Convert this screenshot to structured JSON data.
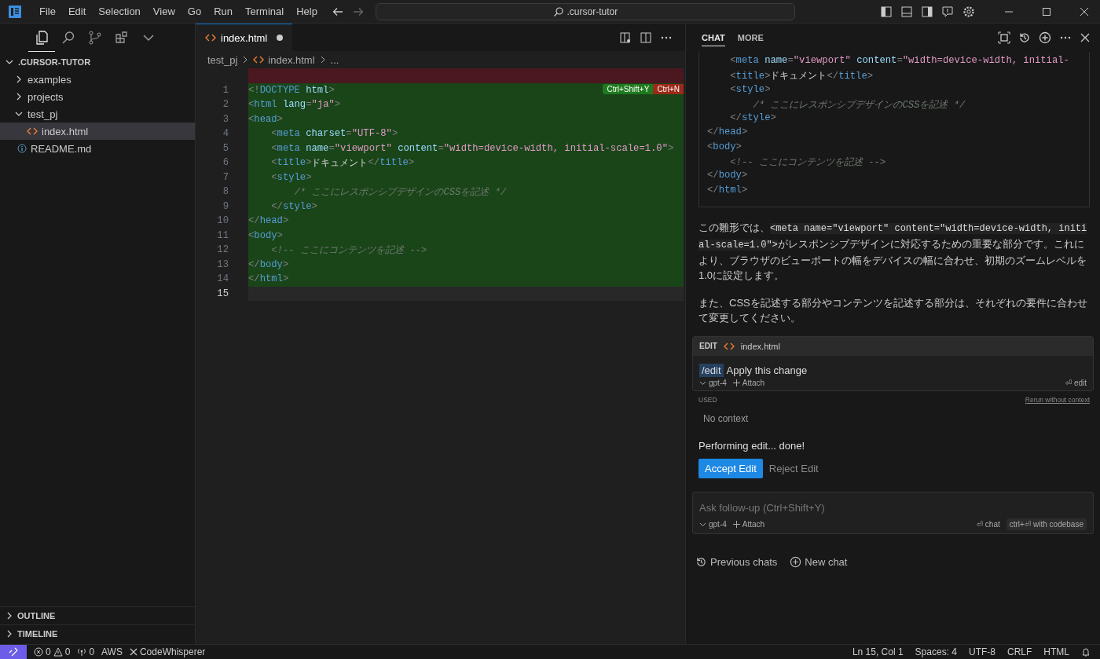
{
  "title_bar": {
    "menus": [
      "File",
      "Edit",
      "Selection",
      "View",
      "Go",
      "Run",
      "Terminal",
      "Help"
    ],
    "search": {
      "value": ".cursor-tutor"
    }
  },
  "sidebar": {
    "views": [
      {
        "selected": true
      },
      {
        "selected": false
      },
      {
        "selected": false
      },
      {
        "selected": false
      },
      {
        "selected": false
      }
    ],
    "tree": [
      {
        "label": ".CURSOR-TUTOR",
        "kind": "root",
        "expanded": true,
        "selected": false,
        "children": [
          {
            "label": "examples",
            "kind": "folder",
            "expanded": false,
            "selected": false
          },
          {
            "label": "projects",
            "kind": "folder",
            "expanded": false,
            "selected": false
          },
          {
            "label": "test_pj",
            "kind": "folder",
            "expanded": true,
            "selected": false,
            "children": [
              {
                "label": "index.html",
                "kind": "html",
                "selected": true
              }
            ]
          },
          {
            "label": "README.md",
            "kind": "info",
            "selected": false
          }
        ]
      }
    ],
    "sections": [
      {
        "label": "OUTLINE",
        "expanded": false
      },
      {
        "label": "TIMELINE",
        "expanded": false
      }
    ]
  },
  "editor": {
    "tab": {
      "label": "index.html",
      "modified": true
    },
    "breadcrumb": [
      "test_pj",
      "index.html",
      "..."
    ],
    "diff_actions": [
      {
        "label": "Ctrl+Shift+Y",
        "kind": "accept"
      },
      {
        "label": "Ctrl+N",
        "kind": "reject"
      }
    ],
    "lines": [
      {
        "kind": "removed",
        "current": false
      },
      {
        "number": "1",
        "kind": "added",
        "current": false,
        "tokens": [
          {
            "kind": "p",
            "t": "<!"
          },
          {
            "kind": "tag",
            "t": "DOCTYPE"
          },
          {
            "kind": "attr",
            "t": " html"
          },
          {
            "kind": "p",
            "t": ">"
          }
        ]
      },
      {
        "number": "2",
        "kind": "added",
        "current": false,
        "tokens": [
          {
            "kind": "p",
            "t": "<"
          },
          {
            "kind": "tag",
            "t": "html"
          },
          {
            "kind": "attr",
            "t": " lang"
          },
          {
            "kind": "p",
            "t": "="
          },
          {
            "kind": "str",
            "t": "\"ja\""
          },
          {
            "kind": "p",
            "t": ">"
          }
        ]
      },
      {
        "number": "3",
        "kind": "added",
        "current": false,
        "tokens": [
          {
            "kind": "p",
            "t": "<"
          },
          {
            "kind": "tag",
            "t": "head"
          },
          {
            "kind": "p",
            "t": ">"
          }
        ]
      },
      {
        "number": "4",
        "kind": "added",
        "current": false,
        "tokens": [
          {
            "kind": "p",
            "t": "    <"
          },
          {
            "kind": "tag",
            "t": "meta"
          },
          {
            "kind": "attr",
            "t": " charset"
          },
          {
            "kind": "p",
            "t": "="
          },
          {
            "kind": "str",
            "t": "\"UTF-8\""
          },
          {
            "kind": "p",
            "t": ">"
          }
        ]
      },
      {
        "number": "5",
        "kind": "added",
        "current": false,
        "tokens": [
          {
            "kind": "p",
            "t": "    <"
          },
          {
            "kind": "tag",
            "t": "meta"
          },
          {
            "kind": "attr",
            "t": " name"
          },
          {
            "kind": "p",
            "t": "="
          },
          {
            "kind": "str",
            "t": "\"viewport\""
          },
          {
            "kind": "attr",
            "t": " content"
          },
          {
            "kind": "p",
            "t": "="
          },
          {
            "kind": "str",
            "t": "\"width=device-width, initial-scale=1.0\""
          },
          {
            "kind": "p",
            "t": ">"
          }
        ]
      },
      {
        "number": "6",
        "kind": "added",
        "current": false,
        "tokens": [
          {
            "kind": "p",
            "t": "    <"
          },
          {
            "kind": "tag",
            "t": "title"
          },
          {
            "kind": "p",
            "t": ">"
          },
          {
            "kind": "text",
            "t": "ドキュメント"
          },
          {
            "kind": "p",
            "t": "</"
          },
          {
            "kind": "tag",
            "t": "title"
          },
          {
            "kind": "p",
            "t": ">"
          }
        ]
      },
      {
        "number": "7",
        "kind": "added",
        "current": false,
        "tokens": [
          {
            "kind": "p",
            "t": "    <"
          },
          {
            "kind": "tag",
            "t": "style"
          },
          {
            "kind": "p",
            "t": ">"
          }
        ]
      },
      {
        "number": "8",
        "kind": "added",
        "current": false,
        "tokens": [
          {
            "kind": "com",
            "t": "        /* ここにレスポンシブデザインのCSSを記述 */"
          }
        ]
      },
      {
        "number": "9",
        "kind": "added",
        "current": false,
        "tokens": [
          {
            "kind": "p",
            "t": "    </"
          },
          {
            "kind": "tag",
            "t": "style"
          },
          {
            "kind": "p",
            "t": ">"
          }
        ]
      },
      {
        "number": "10",
        "kind": "added",
        "current": false,
        "tokens": [
          {
            "kind": "p",
            "t": "</"
          },
          {
            "kind": "tag",
            "t": "head"
          },
          {
            "kind": "p",
            "t": ">"
          }
        ]
      },
      {
        "number": "11",
        "kind": "added",
        "current": false,
        "tokens": [
          {
            "kind": "p",
            "t": "<"
          },
          {
            "kind": "tag",
            "t": "body"
          },
          {
            "kind": "p",
            "t": ">"
          }
        ]
      },
      {
        "number": "12",
        "kind": "added",
        "current": false,
        "tokens": [
          {
            "kind": "com",
            "t": "    <!-- ここにコンテンツを記述 -->"
          }
        ]
      },
      {
        "number": "13",
        "kind": "added",
        "current": false,
        "tokens": [
          {
            "kind": "p",
            "t": "</"
          },
          {
            "kind": "tag",
            "t": "body"
          },
          {
            "kind": "p",
            "t": ">"
          }
        ]
      },
      {
        "number": "14",
        "kind": "added",
        "current": false,
        "tokens": [
          {
            "kind": "p",
            "t": "</"
          },
          {
            "kind": "tag",
            "t": "html"
          },
          {
            "kind": "p",
            "t": ">"
          }
        ]
      },
      {
        "number": "15",
        "kind": "none",
        "current": true
      }
    ]
  },
  "chat": {
    "tabs": [
      {
        "label": "CHAT",
        "selected": true
      },
      {
        "label": "MORE",
        "selected": false
      }
    ],
    "code_block": [
      [
        {
          "kind": "p",
          "t": "    <"
        },
        {
          "kind": "tag",
          "t": "meta"
        },
        {
          "kind": "attr",
          "t": " name"
        },
        {
          "kind": "p",
          "t": "="
        },
        {
          "kind": "str",
          "t": "\"viewport\""
        },
        {
          "kind": "attr",
          "t": " content"
        },
        {
          "kind": "p",
          "t": "="
        },
        {
          "kind": "str",
          "t": "\"width=device-width, initial-"
        }
      ],
      [
        {
          "kind": "p",
          "t": "    <"
        },
        {
          "kind": "tag",
          "t": "title"
        },
        {
          "kind": "p",
          "t": ">"
        },
        {
          "kind": "text",
          "t": "ドキュメント"
        },
        {
          "kind": "p",
          "t": "</"
        },
        {
          "kind": "tag",
          "t": "title"
        },
        {
          "kind": "p",
          "t": ">"
        }
      ],
      [
        {
          "kind": "p",
          "t": "    <"
        },
        {
          "kind": "tag",
          "t": "style"
        },
        {
          "kind": "p",
          "t": ">"
        }
      ],
      [
        {
          "kind": "com",
          "t": "        /* ここにレスポンシブデザインのCSSを記述 */"
        }
      ],
      [
        {
          "kind": "p",
          "t": "    </"
        },
        {
          "kind": "tag",
          "t": "style"
        },
        {
          "kind": "p",
          "t": ">"
        }
      ],
      [
        {
          "kind": "p",
          "t": "</"
        },
        {
          "kind": "tag",
          "t": "head"
        },
        {
          "kind": "p",
          "t": ">"
        }
      ],
      [
        {
          "kind": "p",
          "t": "<"
        },
        {
          "kind": "tag",
          "t": "body"
        },
        {
          "kind": "p",
          "t": ">"
        }
      ],
      [
        {
          "kind": "com",
          "t": "    <!-- ここにコンテンツを記述 -->"
        }
      ],
      [
        {
          "kind": "p",
          "t": "</"
        },
        {
          "kind": "tag",
          "t": "body"
        },
        {
          "kind": "p",
          "t": ">"
        }
      ],
      [
        {
          "kind": "p",
          "t": "</"
        },
        {
          "kind": "tag",
          "t": "html"
        },
        {
          "kind": "p",
          "t": ">"
        }
      ]
    ],
    "paragraphs": [
      [
        {
          "kind": "text",
          "text": "この雛形では、"
        },
        {
          "kind": "code",
          "text": "<meta name=\"viewport\" content=\"width=device-width, initial-scale=1.0\">"
        },
        {
          "kind": "text",
          "text": "がレスポンシブデザインに対応するための重要な部分です。これにより、ブラウザのビューポートの幅をデバイスの幅に合わせ、初期のズームレベルを1.0に設定します。"
        }
      ],
      [
        {
          "kind": "text",
          "text": "また、CSSを記述する部分やコンテンツを記述する部分は、それぞれの要件に合わせて変更してください。"
        }
      ]
    ],
    "edit_card": {
      "label": "EDIT",
      "file": "index.html",
      "command": "/edit",
      "message": "Apply this change",
      "model": "gpt-4",
      "attach": "Attach",
      "submit": "⏎ edit"
    },
    "used": {
      "label": "USED",
      "link": "Rerun without context",
      "context": "No context"
    },
    "status": "Performing edit... done!",
    "accept": "Accept Edit",
    "reject": "Reject Edit",
    "input": {
      "placeholder": "Ask follow-up (Ctrl+Shift+Y)",
      "model": "gpt-4",
      "attach": "Attach",
      "chat": "⏎ chat",
      "codebase": "ctrl+⏎ with codebase"
    },
    "footer": {
      "previous": "Previous chats",
      "new": "New chat"
    }
  },
  "status_bar": {
    "errors": "0",
    "warnings": "0",
    "ports": "0",
    "aws": "AWS",
    "codewhisperer": "CodeWhisperer",
    "position": "Ln 15, Col 1",
    "spaces": "Spaces: 4",
    "encoding": "UTF-8",
    "eol": "CRLF",
    "language": "HTML"
  }
}
